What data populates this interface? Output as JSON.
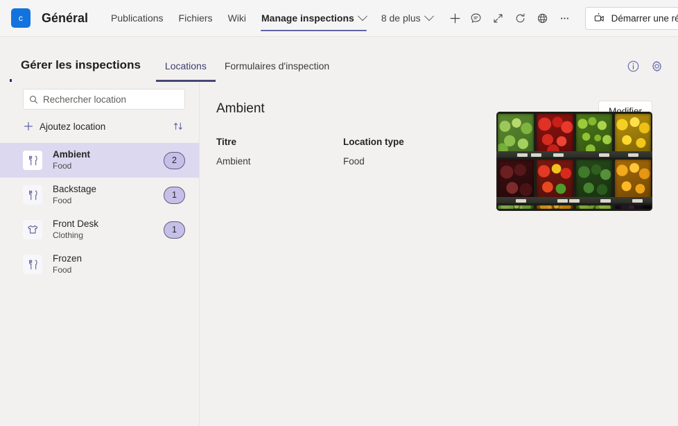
{
  "teams_bar": {
    "avatar_letter": "c",
    "channel_title": "Général",
    "tabs": [
      {
        "label": "Publications",
        "has_chevron": false,
        "active": false
      },
      {
        "label": "Fichiers",
        "has_chevron": false,
        "active": false
      },
      {
        "label": "Wiki",
        "has_chevron": false,
        "active": false
      },
      {
        "label": "Manage inspections",
        "has_chevron": true,
        "active": true
      },
      {
        "label": "8 de plus",
        "has_chevron": true,
        "active": false
      }
    ],
    "add_tab_icon": "plus-icon",
    "icons": [
      "chat-icon",
      "expand-icon",
      "refresh-icon",
      "globe-icon",
      "more-options-icon"
    ],
    "meeting_button": {
      "label": "Démarrer une réunion",
      "icon": "video-camera-icon",
      "dropdown_icon": "chevron-down-icon"
    },
    "accent_color": "#6264a7",
    "avatar_color": "#1273de"
  },
  "app": {
    "title": "Gérer les inspections",
    "tabs": [
      {
        "label": "Locations",
        "active": true
      },
      {
        "label": "Formulaires d'inspection",
        "active": false
      }
    ],
    "header_icons": [
      "info-icon",
      "gear-icon"
    ],
    "tab_underline_color": "#464775"
  },
  "sidebar": {
    "search": {
      "placeholder": "Rechercher location",
      "value": "",
      "icon": "search-icon"
    },
    "add_location": {
      "label": "Ajoutez location",
      "icon": "plus-icon"
    },
    "sort_icon": "sort-arrows-icon",
    "items": [
      {
        "name": "Ambient",
        "type": "Food",
        "badge": "2",
        "icon": "food-icon",
        "selected": true
      },
      {
        "name": "Backstage",
        "type": "Food",
        "badge": "1",
        "icon": "food-icon",
        "selected": false
      },
      {
        "name": "Front Desk",
        "type": "Clothing",
        "badge": "1",
        "icon": "clothing-icon",
        "selected": false
      },
      {
        "name": "Frozen",
        "type": "Food",
        "badge": "",
        "icon": "food-icon",
        "selected": false
      }
    ],
    "selected_bg": "#dcd8f0",
    "badge_bg": "#c6bfe8"
  },
  "detail": {
    "title": "Ambient",
    "edit_button": "Modifier",
    "fields": [
      {
        "label": "Titre",
        "value": "Ambient"
      },
      {
        "label": "Location type",
        "value": "Food"
      }
    ],
    "photo_alt": "produce-shelves-photo"
  }
}
